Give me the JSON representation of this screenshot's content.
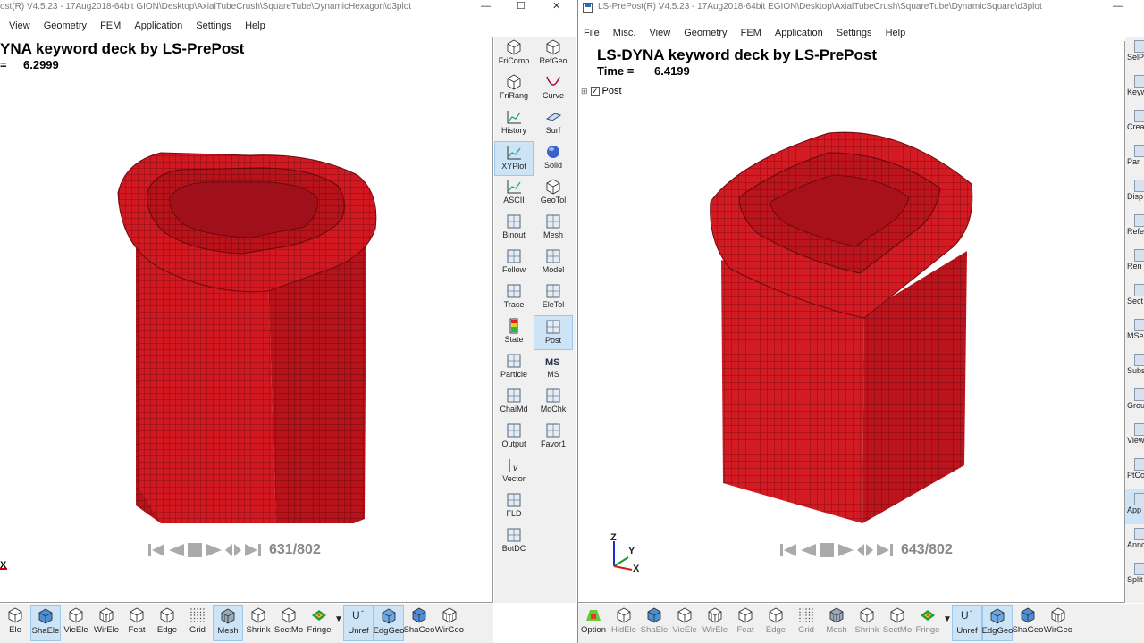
{
  "left": {
    "title": "ost(R) V4.5.23 - 17Aug2018-64bit GION\\Desktop\\AxialTubeCrush\\SquareTube\\DynamicHexagon\\d3plot",
    "menu": [
      "View",
      "Geometry",
      "FEM",
      "Application",
      "Settings",
      "Help"
    ],
    "header_title": "YNA keyword deck by LS-PrePost",
    "time_label": "=",
    "time_value": "6.2999",
    "frame": "631/802",
    "axis_x": "X"
  },
  "right": {
    "title": "LS-PrePost(R) V4.5.23 - 17Aug2018-64bit EGION\\Desktop\\AxialTubeCrush\\SquareTube\\DynamicSquare\\d3plot",
    "menu": [
      "File",
      "Misc.",
      "View",
      "Geometry",
      "FEM",
      "Application",
      "Settings",
      "Help"
    ],
    "header_title": "LS-DYNA keyword deck by LS-PrePost",
    "time_label": "Time =",
    "time_value": "6.4199",
    "tree_label": "Post",
    "frame": "643/802",
    "axis": {
      "z": "Z",
      "y": "Y",
      "x": "X"
    }
  },
  "side_panel": {
    "col1": [
      {
        "label": "FriComp",
        "icon": "cube-colored-icon"
      },
      {
        "label": "FriRang",
        "icon": "cube-range-icon"
      },
      {
        "label": "History",
        "icon": "history-plot-icon"
      },
      {
        "label": "XYPlot",
        "icon": "xyplot-icon",
        "selected": true
      },
      {
        "label": "ASCII",
        "icon": "ascii-plot-icon"
      },
      {
        "label": "Binout",
        "icon": "binout-icon"
      },
      {
        "label": "Follow",
        "icon": "follow-icon"
      },
      {
        "label": "Trace",
        "icon": "trace-icon"
      },
      {
        "label": "State",
        "icon": "state-icon"
      },
      {
        "label": "Particle",
        "icon": "particle-icon"
      },
      {
        "label": "ChaiMd",
        "icon": "chaimd-icon"
      },
      {
        "label": "Output",
        "icon": "output-icon"
      },
      {
        "label": "Vector",
        "icon": "vector-icon"
      },
      {
        "label": "FLD",
        "icon": "fld-icon"
      },
      {
        "label": "BotDC",
        "icon": "botdc-icon"
      }
    ],
    "col2": [
      {
        "label": "RefGeo",
        "icon": "refgeo-icon"
      },
      {
        "label": "Curve",
        "icon": "curve-icon"
      },
      {
        "label": "Surf",
        "icon": "surf-icon"
      },
      {
        "label": "Solid",
        "icon": "solid-icon"
      },
      {
        "label": "GeoTol",
        "icon": "geotol-icon"
      },
      {
        "label": "Mesh",
        "icon": "mesh-icon"
      },
      {
        "label": "Model",
        "icon": "model-icon"
      },
      {
        "label": "EleTol",
        "icon": "eletol-icon"
      },
      {
        "label": "Post",
        "icon": "post-icon",
        "selected": true
      },
      {
        "label": "MS",
        "icon": "ms-icon"
      },
      {
        "label": "MdChk",
        "icon": "mdchk-icon"
      },
      {
        "label": "Favor1",
        "icon": "favor-icon"
      }
    ]
  },
  "bottom_left": [
    {
      "label": "Ele",
      "icon": "cube-icon"
    },
    {
      "label": "ShaEle",
      "icon": "shaded-cube-icon",
      "selected": true
    },
    {
      "label": "VieEle",
      "icon": "cube-icon"
    },
    {
      "label": "WirEle",
      "icon": "wire-cube-icon"
    },
    {
      "label": "Feat",
      "icon": "cube-icon"
    },
    {
      "label": "Edge",
      "icon": "edge-cube-icon"
    },
    {
      "label": "Grid",
      "icon": "grid-dots-icon"
    },
    {
      "label": "Mesh",
      "icon": "mesh-cube-icon",
      "selected": true
    },
    {
      "label": "Shrink",
      "icon": "shrink-cube-icon"
    },
    {
      "label": "SectMo",
      "icon": "section-cube-icon"
    },
    {
      "label": "Fringe",
      "icon": "fringe-icon"
    },
    {
      "label": "Unref",
      "icon": "unref-icon",
      "selected": true
    },
    {
      "label": "EdgGeo",
      "icon": "edge-geo-icon",
      "selected": true
    },
    {
      "label": "ShaGeo",
      "icon": "shaded-geo-icon"
    },
    {
      "label": "WirGeo",
      "icon": "wire-geo-icon"
    }
  ],
  "bottom_right": [
    {
      "label": "Option",
      "icon": "option-icon"
    },
    {
      "label": "HidEle",
      "icon": "cube-icon",
      "dim": true
    },
    {
      "label": "ShaEle",
      "icon": "shaded-cube-icon",
      "dim": true
    },
    {
      "label": "VieEle",
      "icon": "cube-icon",
      "dim": true
    },
    {
      "label": "WirEle",
      "icon": "wire-cube-icon",
      "dim": true
    },
    {
      "label": "Feat",
      "icon": "cube-icon",
      "dim": true
    },
    {
      "label": "Edge",
      "icon": "edge-cube-icon",
      "dim": true
    },
    {
      "label": "Grid",
      "icon": "grid-dots-icon",
      "dim": true
    },
    {
      "label": "Mesh",
      "icon": "mesh-cube-icon",
      "dim": true
    },
    {
      "label": "Shrink",
      "icon": "shrink-cube-icon",
      "dim": true
    },
    {
      "label": "SectMo",
      "icon": "section-cube-icon",
      "dim": true
    },
    {
      "label": "Fringe",
      "icon": "fringe-icon",
      "dim": true
    },
    {
      "label": "Unref",
      "icon": "unref-icon",
      "selected": true
    },
    {
      "label": "EdgGeo",
      "icon": "edge-geo-icon",
      "selected": true
    },
    {
      "label": "ShaGeo",
      "icon": "shaded-geo-icon"
    },
    {
      "label": "WirGeo",
      "icon": "wire-geo-icon"
    }
  ],
  "right_side_panel": [
    "SelP",
    "Keyw",
    "Crea",
    "Par",
    "Disp",
    "Refe",
    "Ren",
    "Sect",
    "MSe",
    "Subs",
    "Grou",
    "View",
    "PtCo",
    "App",
    "Anno",
    "Split"
  ],
  "colors": {
    "mesh_red": "#d0161e",
    "mesh_dark": "#8e0d12",
    "selected_bg": "#cde4f7"
  }
}
